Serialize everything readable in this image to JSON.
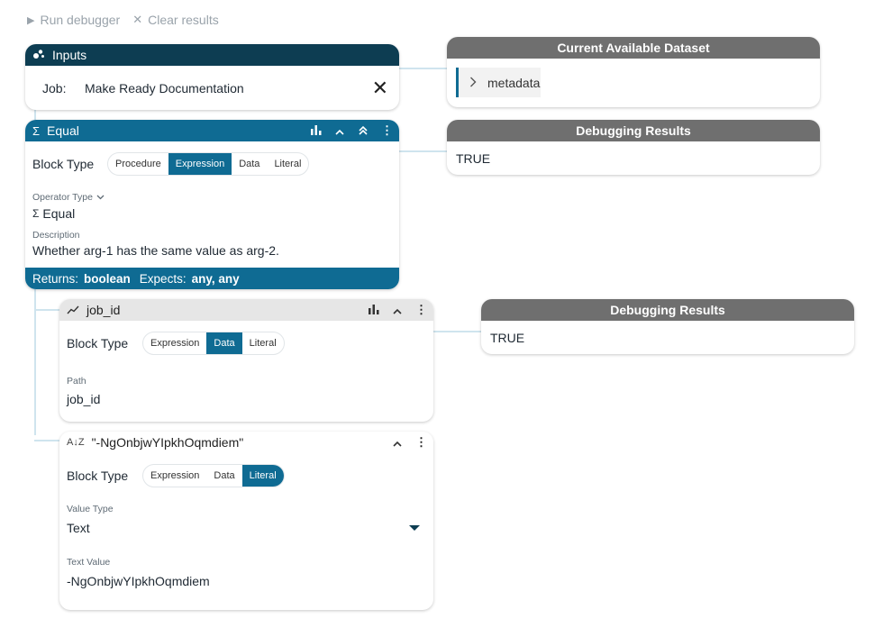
{
  "toolbar": {
    "run_label": "Run debugger",
    "clear_label": "Clear results"
  },
  "inputs_card": {
    "title": "Inputs",
    "job_label": "Job:",
    "job_value": "Make Ready Documentation"
  },
  "dataset_card": {
    "title": "Current Available Dataset",
    "item": "metadata"
  },
  "equal_card": {
    "title": "Equal",
    "block_type_label": "Block Type",
    "block_types": [
      "Procedure",
      "Expression",
      "Data",
      "Literal"
    ],
    "active_block_type": "Expression",
    "operator_type_label": "Operator Type",
    "operator_value": "Equal",
    "description_label": "Description",
    "description_value": "Whether arg-1 has the same value as arg-2.",
    "returns_label": "Returns:",
    "returns_value": "boolean",
    "expects_label": "Expects:",
    "expects_value": "any, any"
  },
  "debug_results_1": {
    "title": "Debugging Results",
    "value": "TRUE"
  },
  "job_id_card": {
    "title": "job_id",
    "block_type_label": "Block Type",
    "block_types": [
      "Expression",
      "Data",
      "Literal"
    ],
    "active_block_type": "Data",
    "path_label": "Path",
    "path_value": "job_id"
  },
  "debug_results_2": {
    "title": "Debugging Results",
    "value": "TRUE"
  },
  "literal_card": {
    "title": "\"-NgOnbjwYIpkhOqmdiem\"",
    "block_type_label": "Block Type",
    "block_types": [
      "Expression",
      "Data",
      "Literal"
    ],
    "active_block_type": "Literal",
    "value_type_label": "Value Type",
    "value_type_value": "Text",
    "text_value_label": "Text Value",
    "text_value": "-NgOnbjwYIpkhOqmdiem"
  },
  "colors": {
    "dark_header": "#0d3d52",
    "accent": "#0f6b93",
    "result_header": "#6f6f6f",
    "connector": "#cfe4ee"
  },
  "icons": {
    "run": "play-icon",
    "clear": "close-icon",
    "inputs": "inputs-icon",
    "equal": "sigma-icon",
    "job_id": "trend-line-icon",
    "literal": "text-az-icon"
  }
}
